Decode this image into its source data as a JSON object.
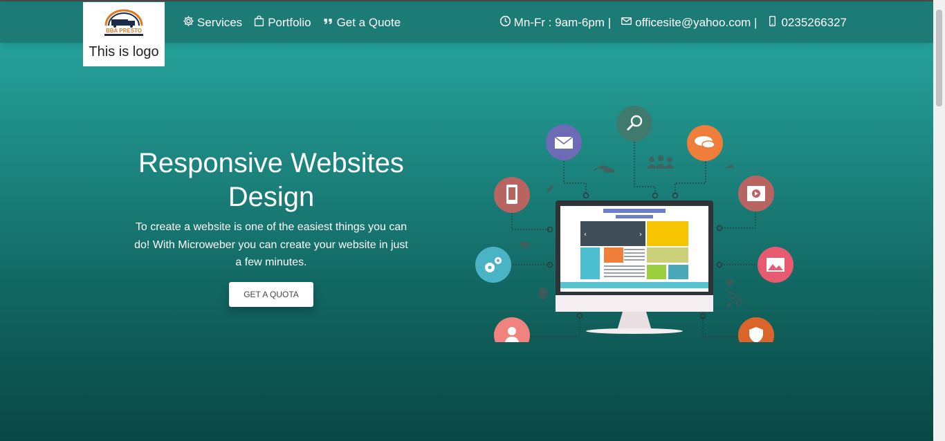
{
  "logo": {
    "brand": "BBA PRESTO",
    "caption": "This is logo"
  },
  "nav": {
    "items": [
      {
        "label": "Services",
        "icon": "gear-icon"
      },
      {
        "label": "Portfolio",
        "icon": "bag-icon"
      },
      {
        "label": "Get a Quote",
        "icon": "quote-icon"
      }
    ]
  },
  "contact": {
    "hours": "Mn-Fr : 9am-6pm |",
    "email": "officesite@yahoo.com |",
    "phone": "0235266327"
  },
  "hero": {
    "title": "Responsive Websites Design",
    "subtitle": "To create a website is one of the easiest things you can do! With Microweber you can create your website in just a few minutes.",
    "cta": "GET A QUOTA"
  },
  "colors": {
    "navbar": "#1d7b75",
    "gradient_top": "#27aba3",
    "gradient_bottom": "#0a4744"
  }
}
